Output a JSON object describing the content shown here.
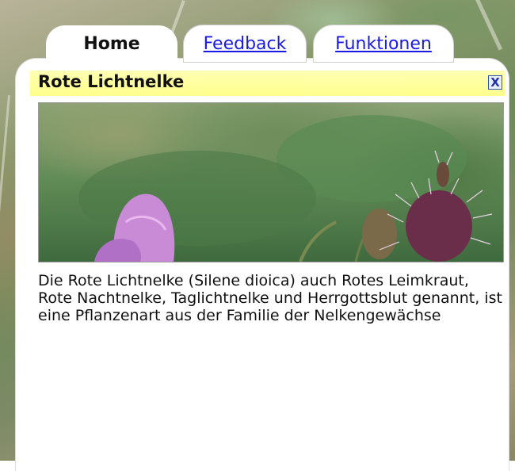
{
  "tabs": {
    "home": "Home",
    "feedback": "Feedback",
    "funktionen": "Funktionen"
  },
  "panel": {
    "title": "Rote Lichtnelke",
    "close_symbol": "X",
    "description": "Die Rote Lichtnelke (Silene dioica) auch Rotes Leimkraut, Rote Nachtnelke, Taglichtnelke und Herrgottsblut genannt, ist eine Pflanzenart aus der Familie der Nelkengewächse"
  },
  "colors": {
    "header_bg": "#ffff8c",
    "link": "#1a1ae6",
    "close_border": "#3050b0"
  },
  "icons": {
    "close": "close-icon"
  }
}
